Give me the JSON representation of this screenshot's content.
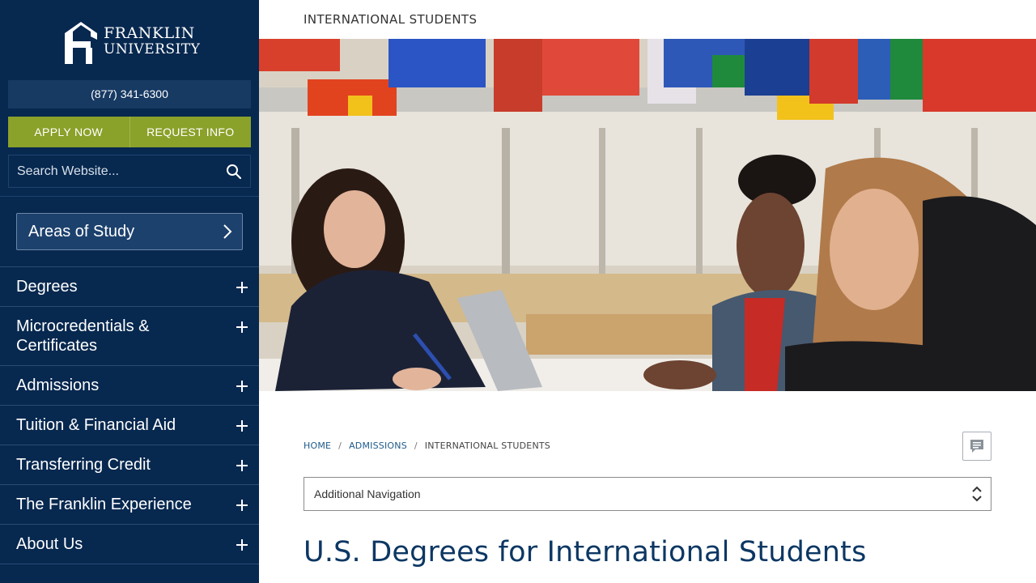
{
  "brand": {
    "name_line1": "FRANKLIN",
    "name_line2": "UNIVERSITY",
    "logo_icon": "franklin-f-logo"
  },
  "sidebar": {
    "phone": "(877) 341-6300",
    "apply_label": "APPLY NOW",
    "request_label": "REQUEST INFO",
    "search": {
      "placeholder": "Search Website...",
      "value": "",
      "icon": "search-icon"
    },
    "areas_label": "Areas of Study",
    "nav_items": [
      {
        "label": "Degrees"
      },
      {
        "label": "Microcredentials & Certificates"
      },
      {
        "label": "Admissions"
      },
      {
        "label": "Tuition & Financial Aid"
      },
      {
        "label": "Transferring Credit"
      },
      {
        "label": "The Franklin Experience"
      },
      {
        "label": "About Us"
      }
    ]
  },
  "main": {
    "kicker": "INTERNATIONAL STUDENTS",
    "hero": {
      "image_description_icon": "students-photo"
    },
    "breadcrumb": [
      {
        "label": "HOME"
      },
      {
        "label": "ADMISSIONS"
      },
      {
        "label": "INTERNATIONAL STUDENTS"
      }
    ],
    "feedback_icon": "chat-bubble-icon",
    "additional_nav_label": "Additional Navigation",
    "title": "U.S. Degrees for International Students"
  },
  "colors": {
    "sidebar_bg": "#07284f",
    "cta_green": "#8aa12a",
    "title_blue": "#0c3763",
    "link_blue": "#1d5a8a"
  }
}
